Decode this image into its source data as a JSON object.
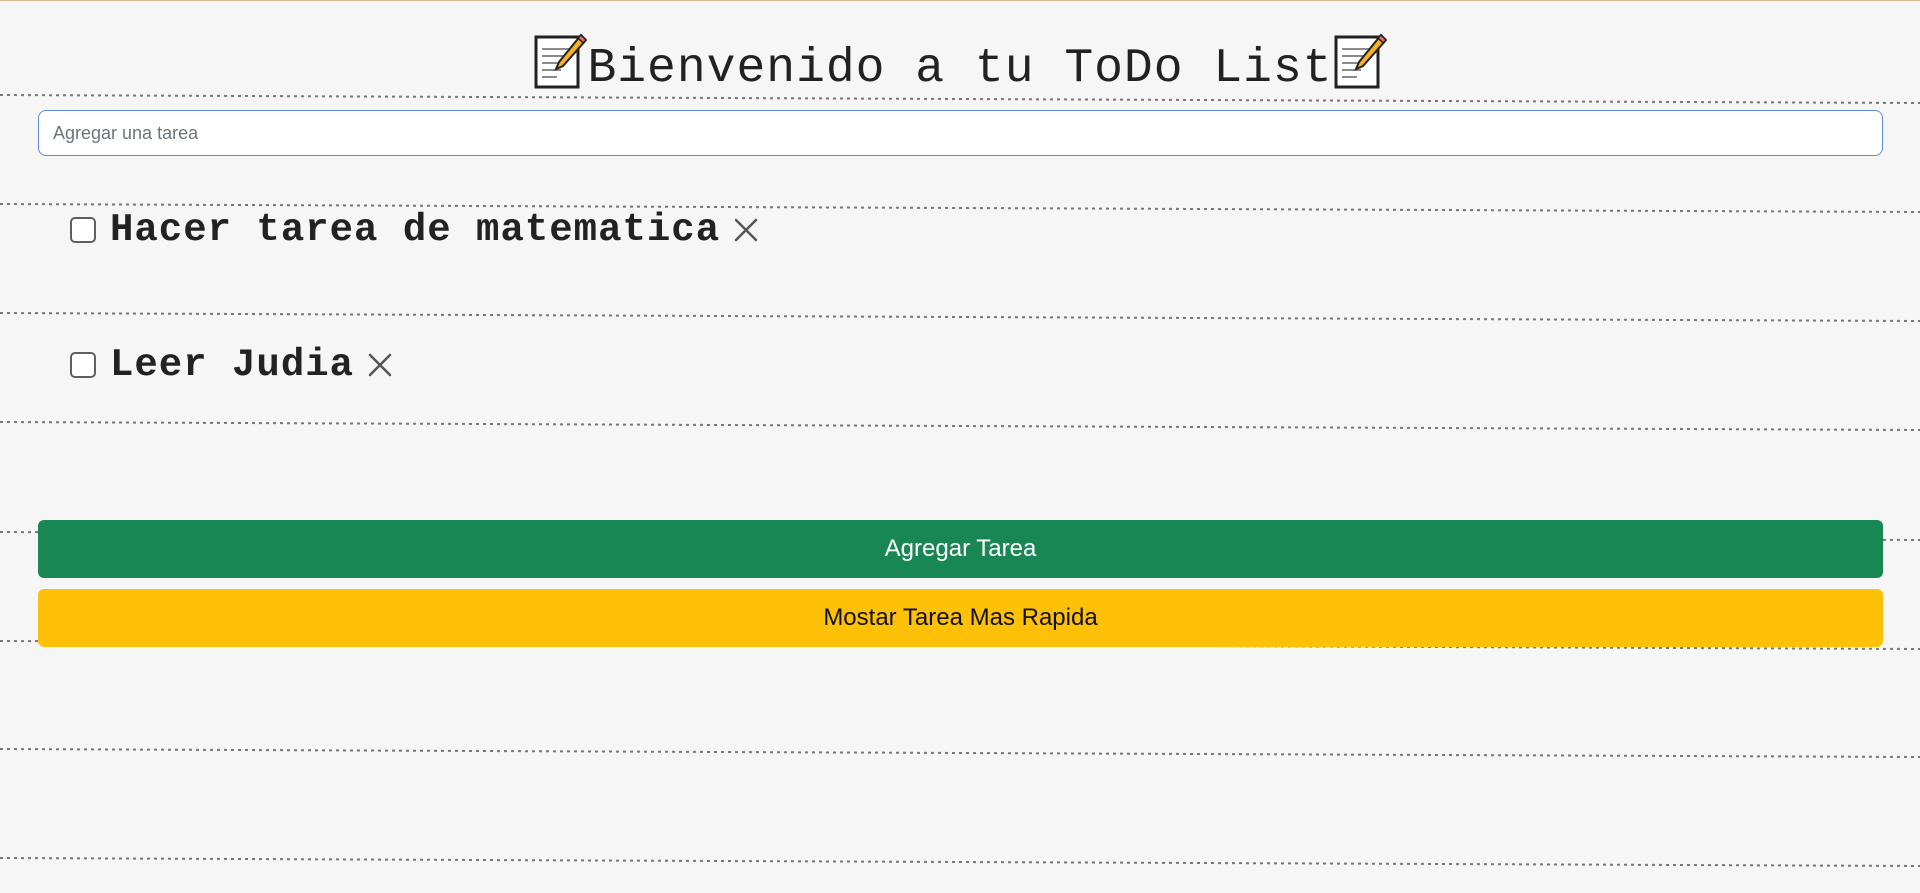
{
  "header": {
    "title": "Bienvenido a tu ToDo List",
    "emoji_icon": "memo-icon"
  },
  "input": {
    "placeholder": "Agregar una tarea",
    "value": ""
  },
  "tasks": [
    {
      "label": "Hacer tarea de matematica",
      "checked": false
    },
    {
      "label": "Leer Judia",
      "checked": false
    }
  ],
  "buttons": {
    "add_label": "Agregar Tarea",
    "fastest_label": "Mostar Tarea Mas Rapida"
  },
  "colors": {
    "add_button": "#198754",
    "fastest_button": "#ffc107",
    "input_border": "#5b8bd9",
    "background": "#f6f6f6"
  }
}
